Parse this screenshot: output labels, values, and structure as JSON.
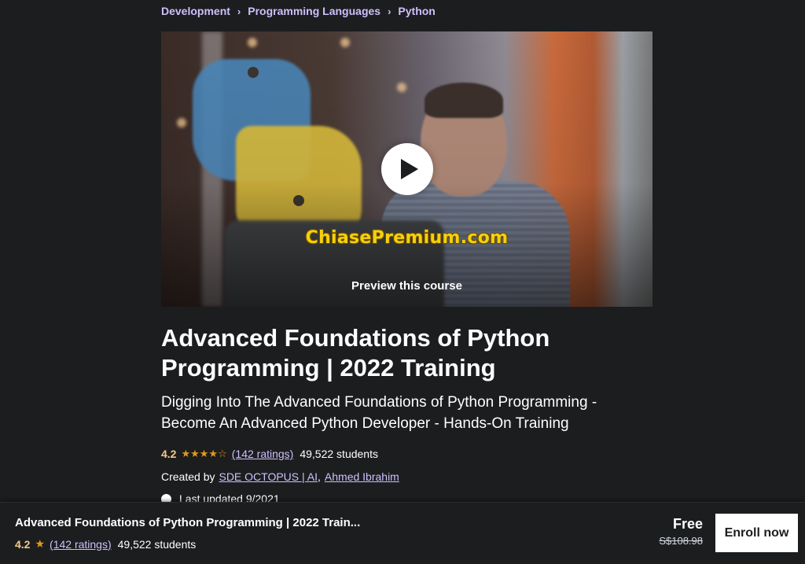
{
  "breadcrumb": {
    "items": [
      "Development",
      "Programming Languages",
      "Python"
    ],
    "separator": "›"
  },
  "video": {
    "watermark": "ChiasePremium.com",
    "preview_label": "Preview this course",
    "play_icon": "play-icon"
  },
  "course": {
    "title": "Advanced Foundations of Python Programming | 2022 Training",
    "subtitle": "Digging Into The Advanced Foundations of Python Programming - Become An Advanced Python Developer - Hands-On Training",
    "rating": "4.2",
    "stars_display": "★★★★",
    "star_half": "☆",
    "ratings_count": "(142 ratings)",
    "students": "49,522 students",
    "created_by_label": "Created by",
    "instructors": [
      "SDE OCTOPUS | AI",
      "Ahmed Ibrahim"
    ],
    "instructor_separator": ",",
    "last_updated": "Last updated 9/2021"
  },
  "sticky_bar": {
    "title": "Advanced Foundations of Python Programming | 2022 Train...",
    "rating": "4.2",
    "star": "★",
    "ratings_count": "(142 ratings)",
    "students": "49,522 students",
    "price": "Free",
    "original_price": "S$108.98",
    "enroll_label": "Enroll now"
  },
  "colors": {
    "background": "#1c1d1f",
    "link": "#cec0fc",
    "rating": "#f3ca8c",
    "star": "#e59819",
    "watermark": "#f5d00d"
  }
}
